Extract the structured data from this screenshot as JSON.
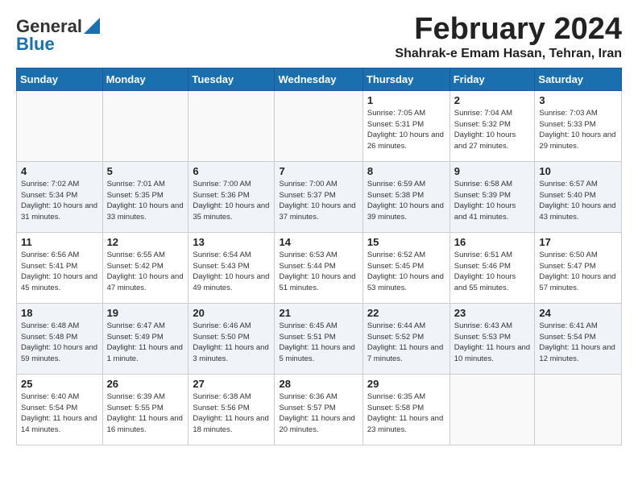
{
  "header": {
    "logo_line1": "General",
    "logo_line2": "Blue",
    "month_year": "February 2024",
    "location": "Shahrak-e Emam Hasan, Tehran, Iran"
  },
  "weekdays": [
    "Sunday",
    "Monday",
    "Tuesday",
    "Wednesday",
    "Thursday",
    "Friday",
    "Saturday"
  ],
  "weeks": [
    [
      {
        "day": "",
        "info": ""
      },
      {
        "day": "",
        "info": ""
      },
      {
        "day": "",
        "info": ""
      },
      {
        "day": "",
        "info": ""
      },
      {
        "day": "1",
        "info": "Sunrise: 7:05 AM\nSunset: 5:31 PM\nDaylight: 10 hours\nand 26 minutes."
      },
      {
        "day": "2",
        "info": "Sunrise: 7:04 AM\nSunset: 5:32 PM\nDaylight: 10 hours\nand 27 minutes."
      },
      {
        "day": "3",
        "info": "Sunrise: 7:03 AM\nSunset: 5:33 PM\nDaylight: 10 hours\nand 29 minutes."
      }
    ],
    [
      {
        "day": "4",
        "info": "Sunrise: 7:02 AM\nSunset: 5:34 PM\nDaylight: 10 hours\nand 31 minutes."
      },
      {
        "day": "5",
        "info": "Sunrise: 7:01 AM\nSunset: 5:35 PM\nDaylight: 10 hours\nand 33 minutes."
      },
      {
        "day": "6",
        "info": "Sunrise: 7:00 AM\nSunset: 5:36 PM\nDaylight: 10 hours\nand 35 minutes."
      },
      {
        "day": "7",
        "info": "Sunrise: 7:00 AM\nSunset: 5:37 PM\nDaylight: 10 hours\nand 37 minutes."
      },
      {
        "day": "8",
        "info": "Sunrise: 6:59 AM\nSunset: 5:38 PM\nDaylight: 10 hours\nand 39 minutes."
      },
      {
        "day": "9",
        "info": "Sunrise: 6:58 AM\nSunset: 5:39 PM\nDaylight: 10 hours\nand 41 minutes."
      },
      {
        "day": "10",
        "info": "Sunrise: 6:57 AM\nSunset: 5:40 PM\nDaylight: 10 hours\nand 43 minutes."
      }
    ],
    [
      {
        "day": "11",
        "info": "Sunrise: 6:56 AM\nSunset: 5:41 PM\nDaylight: 10 hours\nand 45 minutes."
      },
      {
        "day": "12",
        "info": "Sunrise: 6:55 AM\nSunset: 5:42 PM\nDaylight: 10 hours\nand 47 minutes."
      },
      {
        "day": "13",
        "info": "Sunrise: 6:54 AM\nSunset: 5:43 PM\nDaylight: 10 hours\nand 49 minutes."
      },
      {
        "day": "14",
        "info": "Sunrise: 6:53 AM\nSunset: 5:44 PM\nDaylight: 10 hours\nand 51 minutes."
      },
      {
        "day": "15",
        "info": "Sunrise: 6:52 AM\nSunset: 5:45 PM\nDaylight: 10 hours\nand 53 minutes."
      },
      {
        "day": "16",
        "info": "Sunrise: 6:51 AM\nSunset: 5:46 PM\nDaylight: 10 hours\nand 55 minutes."
      },
      {
        "day": "17",
        "info": "Sunrise: 6:50 AM\nSunset: 5:47 PM\nDaylight: 10 hours\nand 57 minutes."
      }
    ],
    [
      {
        "day": "18",
        "info": "Sunrise: 6:48 AM\nSunset: 5:48 PM\nDaylight: 10 hours\nand 59 minutes."
      },
      {
        "day": "19",
        "info": "Sunrise: 6:47 AM\nSunset: 5:49 PM\nDaylight: 11 hours\nand 1 minute."
      },
      {
        "day": "20",
        "info": "Sunrise: 6:46 AM\nSunset: 5:50 PM\nDaylight: 11 hours\nand 3 minutes."
      },
      {
        "day": "21",
        "info": "Sunrise: 6:45 AM\nSunset: 5:51 PM\nDaylight: 11 hours\nand 5 minutes."
      },
      {
        "day": "22",
        "info": "Sunrise: 6:44 AM\nSunset: 5:52 PM\nDaylight: 11 hours\nand 7 minutes."
      },
      {
        "day": "23",
        "info": "Sunrise: 6:43 AM\nSunset: 5:53 PM\nDaylight: 11 hours\nand 10 minutes."
      },
      {
        "day": "24",
        "info": "Sunrise: 6:41 AM\nSunset: 5:54 PM\nDaylight: 11 hours\nand 12 minutes."
      }
    ],
    [
      {
        "day": "25",
        "info": "Sunrise: 6:40 AM\nSunset: 5:54 PM\nDaylight: 11 hours\nand 14 minutes."
      },
      {
        "day": "26",
        "info": "Sunrise: 6:39 AM\nSunset: 5:55 PM\nDaylight: 11 hours\nand 16 minutes."
      },
      {
        "day": "27",
        "info": "Sunrise: 6:38 AM\nSunset: 5:56 PM\nDaylight: 11 hours\nand 18 minutes."
      },
      {
        "day": "28",
        "info": "Sunrise: 6:36 AM\nSunset: 5:57 PM\nDaylight: 11 hours\nand 20 minutes."
      },
      {
        "day": "29",
        "info": "Sunrise: 6:35 AM\nSunset: 5:58 PM\nDaylight: 11 hours\nand 23 minutes."
      },
      {
        "day": "",
        "info": ""
      },
      {
        "day": "",
        "info": ""
      }
    ]
  ]
}
